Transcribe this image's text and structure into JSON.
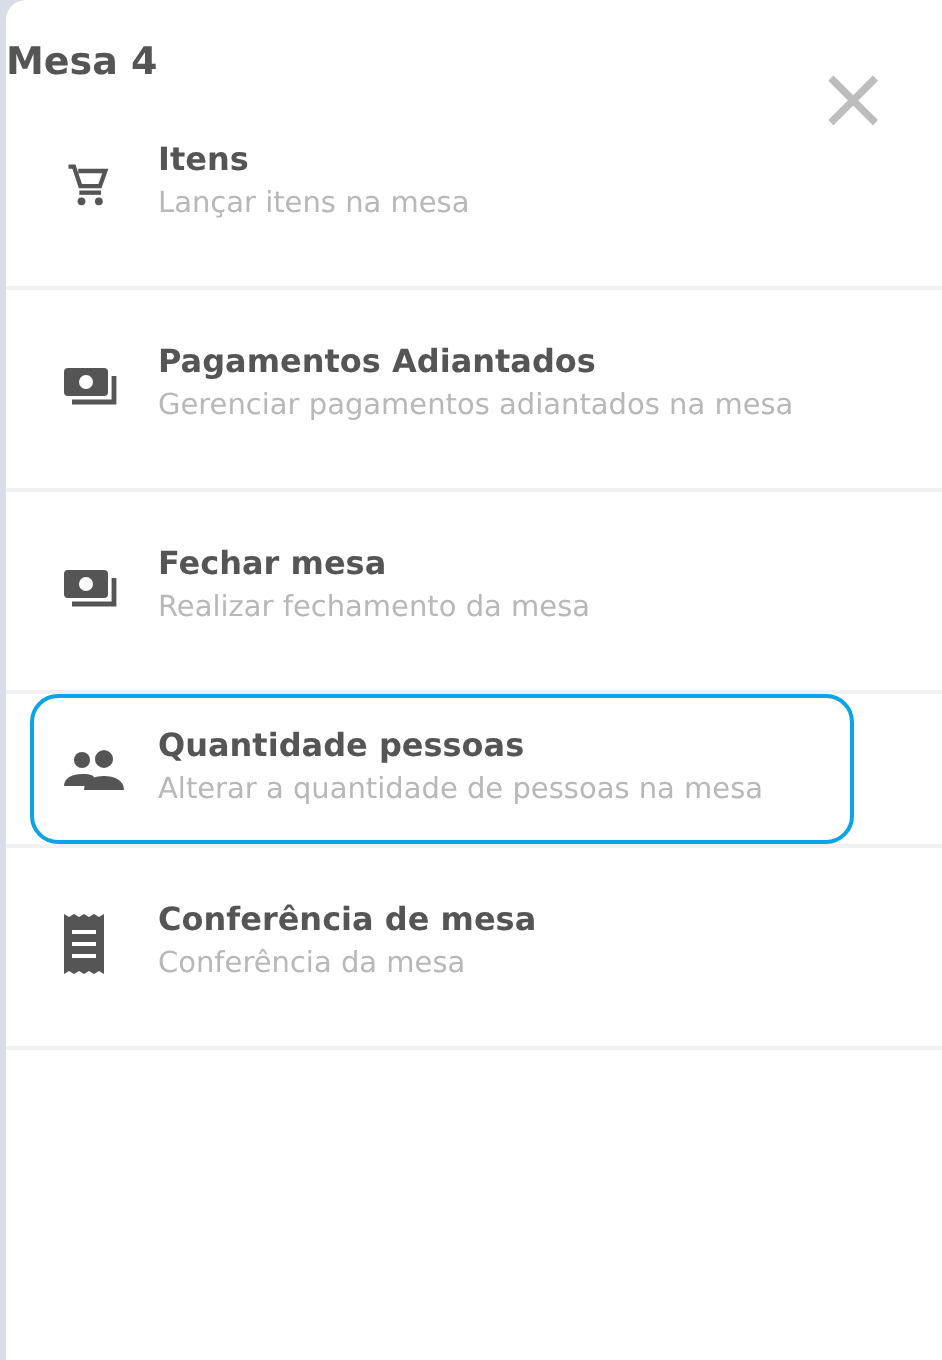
{
  "title": "Mesa 4",
  "close": "×",
  "items": [
    {
      "title": "Itens",
      "subtitle": "Lançar itens na mesa",
      "focused": false
    },
    {
      "title": "Pagamentos Adiantados",
      "subtitle": "Gerenciar pagamentos adiantados na mesa",
      "focused": false
    },
    {
      "title": "Fechar mesa",
      "subtitle": "Realizar fechamento da mesa",
      "focused": false
    },
    {
      "title": "Quantidade pessoas",
      "subtitle": "Alterar a quantidade de pessoas na mesa",
      "focused": true
    },
    {
      "title": "Conferência de mesa",
      "subtitle": "Conferência da mesa",
      "focused": false
    }
  ]
}
